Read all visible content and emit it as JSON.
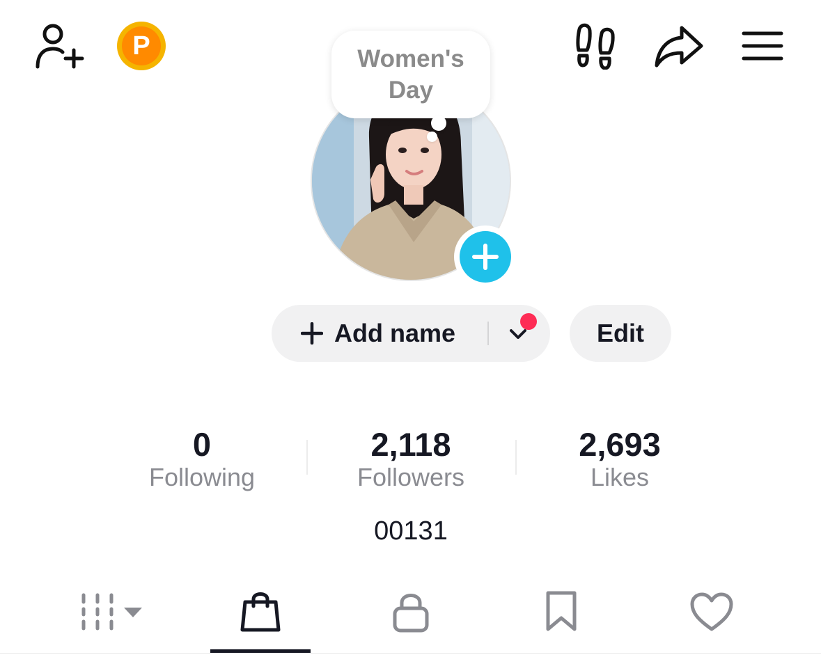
{
  "header": {
    "icons": [
      "add-friend-icon",
      "coin-icon",
      "footprints-icon",
      "share-icon",
      "menu-icon"
    ],
    "coin_letter": "P"
  },
  "profile": {
    "note_bubble": "Women's Day",
    "add_name_label": "Add name",
    "edit_label": "Edit",
    "bio": "00131"
  },
  "stats": [
    {
      "value": "0",
      "label": "Following"
    },
    {
      "value": "2,118",
      "label": "Followers"
    },
    {
      "value": "2,693",
      "label": "Likes"
    }
  ],
  "tabs": [
    {
      "name": "videos",
      "icon": "grid-icon"
    },
    {
      "name": "shop",
      "icon": "shopping-bag-icon"
    },
    {
      "name": "private",
      "icon": "lock-icon"
    },
    {
      "name": "saved",
      "icon": "bookmark-icon"
    },
    {
      "name": "liked",
      "icon": "heart-icon"
    }
  ],
  "colors": {
    "accent_cyan": "#1fc1ea",
    "notification_red": "#fe2c55",
    "coin_orange": "#ff8a00",
    "coin_gold": "#f5b400",
    "pill_bg": "#f1f1f2"
  }
}
